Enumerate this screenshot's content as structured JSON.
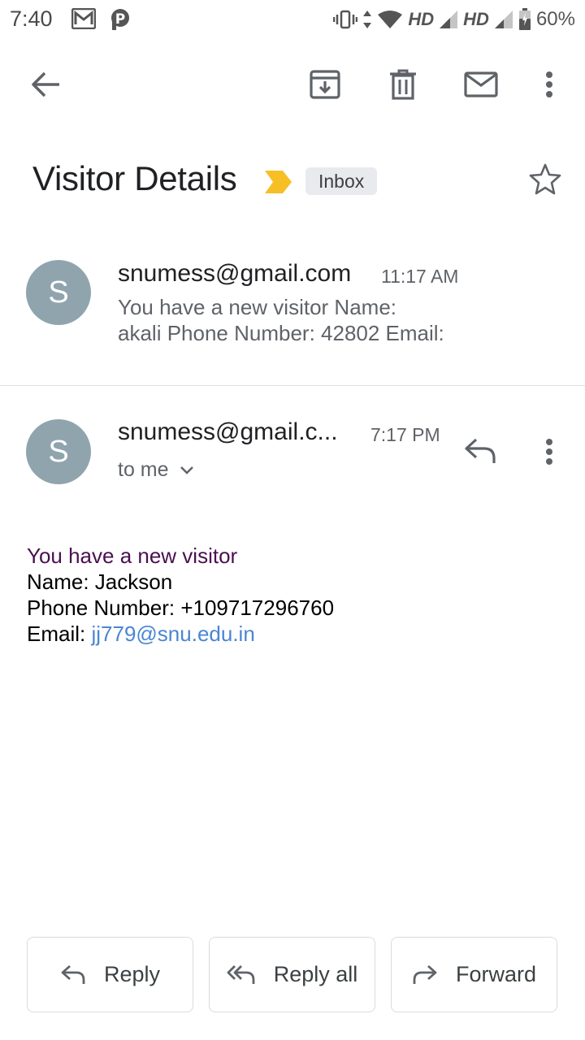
{
  "status_bar": {
    "time": "7:40",
    "net1": "HD",
    "net2": "HD",
    "battery": "60%"
  },
  "toolbar": {
    "back_icon": "arrow-back-icon",
    "archive_icon": "archive-icon",
    "delete_icon": "trash-icon",
    "mark_unread_icon": "mail-icon",
    "more_icon": "more-vert-icon"
  },
  "subject": {
    "title": "Visitor Details",
    "importance_marker_color": "#f6bf26",
    "label": "Inbox"
  },
  "messages": [
    {
      "avatar_letter": "S",
      "sender": "snumess@gmail.com",
      "time": "11:17 AM",
      "snippet_line1": "You have a new visitor Name:",
      "snippet_line2": "akali Phone Number: 42802 Email:"
    },
    {
      "avatar_letter": "S",
      "sender": "snumess@gmail.c...",
      "time": "7:17 PM",
      "recipient": "to me",
      "body": {
        "intro": "You have a new visitor",
        "name_line": "Name: Jackson",
        "phone_line": "Phone Number: +109717296760",
        "email_label": "Email: ",
        "email_link": "jj779@snu.edu.in"
      }
    }
  ],
  "actions": {
    "reply": "Reply",
    "reply_all": "Reply all",
    "forward": "Forward"
  },
  "colors": {
    "avatar": "#90a4ae",
    "intro_text": "#4a1050",
    "link": "#4a86d1"
  }
}
